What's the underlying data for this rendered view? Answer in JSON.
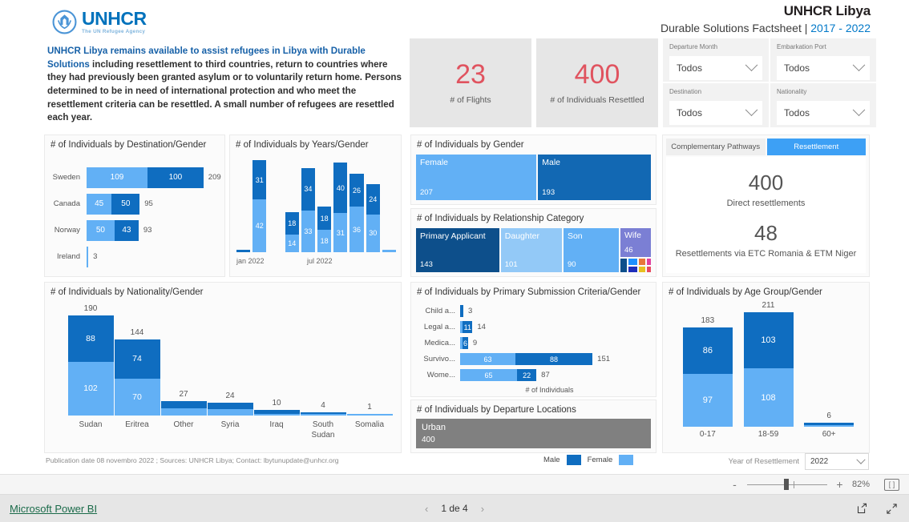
{
  "header": {
    "logo_main": "UNHCR",
    "logo_sub": "The UN Refugee Agency",
    "title": "UNHCR Libya",
    "subtitle_prefix": "Durable Solutions Factsheet | ",
    "subtitle_years": "2017 - 2022"
  },
  "intro": {
    "highlight": "UNHCR Libya remains available to assist refugees in Libya with Durable Solutions",
    "body": " including resettlement to third countries, return to countries where they had previously been granted asylum or to voluntarily return home. Persons determined to be in need of international protection and who meet the resettlement criteria can be resettled. A small number of refugees are resettled each year."
  },
  "kpis": [
    {
      "value": "23",
      "label": "# of Flights"
    },
    {
      "value": "400",
      "label": "# of Individuals Resettled"
    }
  ],
  "slicers": [
    {
      "label": "Departure Month",
      "value": "Todos"
    },
    {
      "label": "Destination",
      "value": "Todos"
    },
    {
      "label": "Embarkation Port",
      "value": "Todos"
    },
    {
      "label": "Nationality",
      "value": "Todos"
    }
  ],
  "pathways": {
    "tab_complementary": "Complementary Pathways",
    "tab_resettlement": "Resettlement",
    "stat1_value": "400",
    "stat1_label": "Direct resettlements",
    "stat2_value": "48",
    "stat2_label": "Resettlements via ETC Romania & ETM Niger"
  },
  "departure_locations": {
    "title": "# of Individuals by Departure Locations",
    "tiles": [
      {
        "name": "Urban",
        "value": "400",
        "color": "#808080"
      }
    ]
  },
  "footer": {
    "publication_prefix": "Publication date",
    "publication_date": "08 novembro 2022",
    "sources": ";   Sources: UNHCR Libya; Contact: lbytunupdate@unhcr.org",
    "legend_male": "Male",
    "legend_female": "Female",
    "year_label": "Year of Resettlement",
    "year_value": "2022"
  },
  "zoombar": {
    "minus": "-",
    "plus": "+",
    "percent": "82%"
  },
  "powerbi": {
    "brand": "Microsoft Power BI",
    "page": "1 de 4",
    "prev": "‹",
    "next": "›"
  },
  "colors": {
    "male": "#0f6dc0",
    "female": "#62b0f5",
    "accent_red": "#e0535f",
    "brand_blue": "#0072bc"
  },
  "chart_data": [
    {
      "type": "bar",
      "orientation": "horizontal",
      "title": "# of Individuals by Destination/Gender",
      "categories": [
        "Sweden",
        "Canada",
        "Norway",
        "Ireland"
      ],
      "series": [
        {
          "name": "Female",
          "values": [
            109,
            45,
            50,
            3
          ]
        },
        {
          "name": "Male",
          "values": [
            100,
            50,
            43,
            0
          ]
        }
      ],
      "totals": [
        209,
        95,
        93,
        3
      ],
      "xlabel": "",
      "ylabel": ""
    },
    {
      "type": "bar",
      "orientation": "vertical",
      "stacked": true,
      "title": "# of Individuals by Years/Gender",
      "categories": [
        "",
        "jan 2022",
        "",
        "",
        "",
        "",
        "",
        "",
        "",
        "jul 2022",
        ""
      ],
      "axis_ticks": [
        "jan 2022",
        "jul 2022"
      ],
      "bars": [
        {
          "female": 0,
          "male": 2,
          "show": false
        },
        {
          "female": 42,
          "male": 31,
          "show": true
        },
        {
          "female": 0,
          "male": 0,
          "show": false
        },
        {
          "female": 14,
          "male": 18,
          "show": true
        },
        {
          "female": 33,
          "male": 34,
          "show": true
        },
        {
          "female": 18,
          "male": 18,
          "show": true
        },
        {
          "female": 31,
          "male": 40,
          "show": true
        },
        {
          "female": 36,
          "male": 26,
          "show": true
        },
        {
          "female": 30,
          "male": 24,
          "show": true
        },
        {
          "female": 2,
          "male": 0,
          "show": false
        }
      ]
    },
    {
      "type": "treemap",
      "title": "# of Individuals by Gender",
      "tiles": [
        {
          "name": "Female",
          "value": "207",
          "color": "#62b0f5"
        },
        {
          "name": "Male",
          "value": "193",
          "color": "#1268b3"
        }
      ]
    },
    {
      "type": "treemap",
      "title": "# of Individuals by Relationship Category",
      "tiles": [
        {
          "name": "Primary Applicant",
          "value": "143",
          "color": "#0d4f8b"
        },
        {
          "name": "Daughter",
          "value": "101",
          "color": "#93c9f7"
        },
        {
          "name": "Son",
          "value": "90",
          "color": "#62b0f5"
        },
        {
          "name": "Wife",
          "value": "46",
          "color": "#7b7fd4"
        }
      ],
      "small_tiles": [
        {
          "color": "#0d4f8b"
        },
        {
          "color": "#1e90ff"
        },
        {
          "color": "#e8763a"
        },
        {
          "color": "#e040a0"
        },
        {
          "color": "#1f2fbb"
        },
        {
          "color": "#e8c020"
        },
        {
          "color": "#e84a5f"
        }
      ]
    },
    {
      "type": "bar",
      "orientation": "horizontal",
      "stacked": true,
      "title": "# of Individuals by Primary Submission Criteria/Gender",
      "categories": [
        "Child a...",
        "Legal a...",
        "Medica...",
        "Survivo...",
        "Wome..."
      ],
      "series": [
        {
          "name": "Female",
          "values": [
            0,
            3,
            3,
            63,
            65
          ]
        },
        {
          "name": "Male",
          "values": [
            3,
            11,
            6,
            88,
            22
          ]
        }
      ],
      "totals": [
        "3",
        "14",
        "9",
        "151",
        "87"
      ],
      "xlabel": "# of Individuals"
    },
    {
      "type": "bar",
      "orientation": "vertical",
      "stacked": true,
      "title": "# of Individuals by Nationality/Gender",
      "categories": [
        "Sudan",
        "Eritrea",
        "Other",
        "Syria",
        "Iraq",
        "South Sudan",
        "Somalia"
      ],
      "series": [
        {
          "name": "Female",
          "values": [
            102,
            70,
            13,
            12,
            3,
            1,
            1
          ]
        },
        {
          "name": "Male",
          "values": [
            88,
            74,
            14,
            12,
            7,
            3,
            0
          ]
        }
      ],
      "totals": [
        190,
        144,
        27,
        24,
        10,
        4,
        1
      ],
      "show_segment_labels": [
        true,
        true,
        false,
        false,
        false,
        false,
        false
      ]
    },
    {
      "type": "bar",
      "orientation": "vertical",
      "stacked": true,
      "title": "# of Individuals by Age Group/Gender",
      "categories": [
        "0-17",
        "18-59",
        "60+"
      ],
      "series": [
        {
          "name": "Female",
          "values": [
            97,
            108,
            2
          ]
        },
        {
          "name": "Male",
          "values": [
            86,
            103,
            4
          ]
        }
      ],
      "totals": [
        183,
        211,
        6
      ],
      "show_segment_labels": [
        true,
        true,
        false
      ]
    }
  ]
}
